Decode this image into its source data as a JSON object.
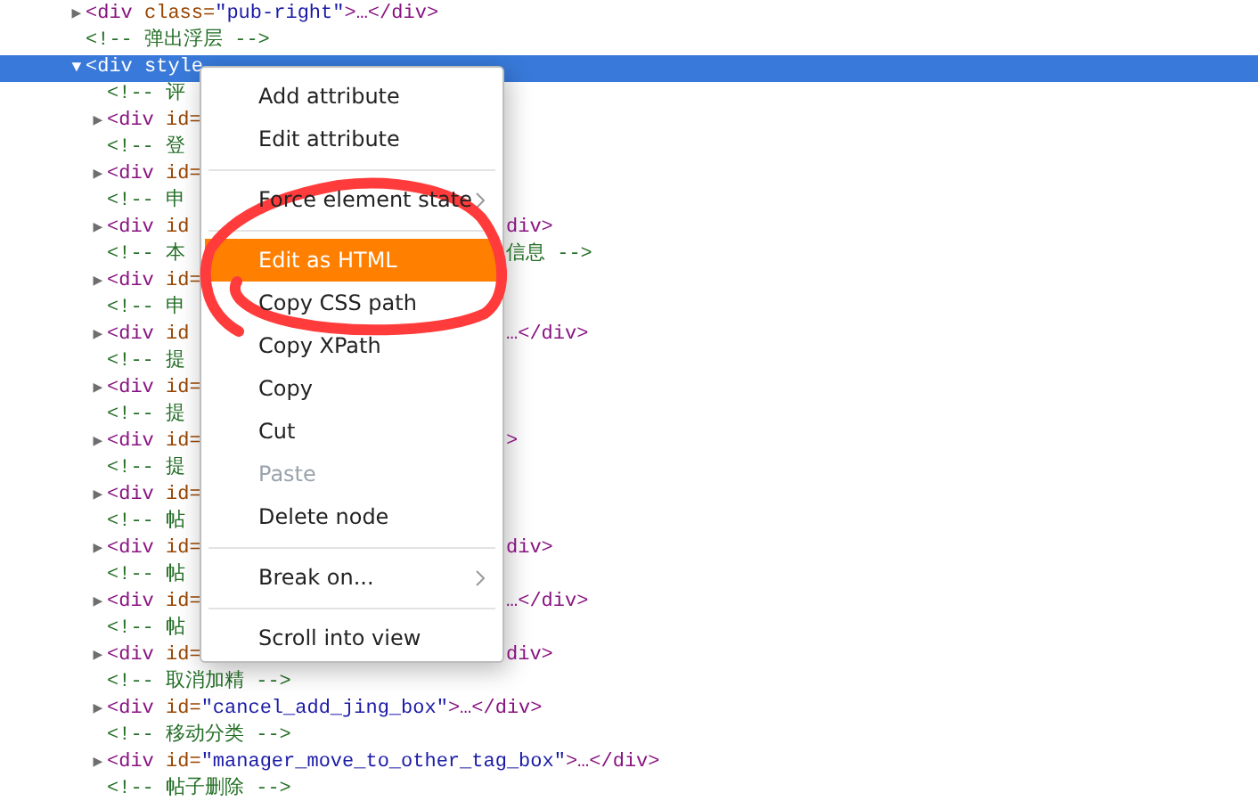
{
  "tree_rows": [
    {
      "kind": "element",
      "expander": "▶",
      "selected": false,
      "open": "<div",
      "attr": "class=",
      "value": "\"pub-right\"",
      "close": ">…</div>"
    },
    {
      "kind": "comment",
      "selected": false,
      "comment": "<!-- 弹出浮层 -->"
    },
    {
      "kind": "element",
      "expander": "▼",
      "selected": true,
      "open": "<div",
      "attr": "style",
      "children": [
        {
          "kind": "comment",
          "selected": false,
          "comment": "<!-- 评"
        },
        {
          "kind": "element",
          "expander": "▶",
          "selected": false,
          "open": "<div",
          "attr": "id="
        },
        {
          "kind": "comment",
          "selected": false,
          "comment": "<!-- 登"
        },
        {
          "kind": "element",
          "expander": "▶",
          "selected": false,
          "open": "<div",
          "attr": "id="
        },
        {
          "kind": "comment",
          "selected": false,
          "comment": "<!-- 申"
        },
        {
          "kind": "element",
          "expander": "▶",
          "selected": false,
          "open": "<div",
          "attr": "id",
          "tail_close": "div>"
        },
        {
          "kind": "comment",
          "selected": false,
          "comment": "<!-- 本",
          "tail_comment": "信息 -->"
        },
        {
          "kind": "element",
          "expander": "▶",
          "selected": false,
          "open": "<div",
          "attr": "id="
        },
        {
          "kind": "comment",
          "selected": false,
          "comment": "<!-- 申"
        },
        {
          "kind": "element",
          "expander": "▶",
          "selected": false,
          "open": "<div",
          "attr": "id",
          "tail_close": "…</div>"
        },
        {
          "kind": "comment",
          "selected": false,
          "comment": "<!-- 提"
        },
        {
          "kind": "element",
          "expander": "▶",
          "selected": false,
          "open": "<div",
          "attr": "id="
        },
        {
          "kind": "comment",
          "selected": false,
          "comment": "<!-- 提"
        },
        {
          "kind": "element",
          "expander": "▶",
          "selected": false,
          "open": "<div",
          "attr": "id=",
          "tail_close": ">"
        },
        {
          "kind": "comment",
          "selected": false,
          "comment": "<!-- 提"
        },
        {
          "kind": "element",
          "expander": "▶",
          "selected": false,
          "open": "<div",
          "attr": "id="
        },
        {
          "kind": "comment",
          "selected": false,
          "comment": "<!-- 帖"
        },
        {
          "kind": "element",
          "expander": "▶",
          "selected": false,
          "open": "<div",
          "attr": "id=",
          "tail_close": "div>"
        },
        {
          "kind": "comment",
          "selected": false,
          "comment": "<!-- 帖"
        },
        {
          "kind": "element",
          "expander": "▶",
          "selected": false,
          "open": "<div",
          "attr": "id=",
          "tail_close": "…</div>"
        },
        {
          "kind": "comment",
          "selected": false,
          "comment": "<!-- 帖"
        },
        {
          "kind": "element",
          "expander": "▶",
          "selected": false,
          "open": "<div",
          "attr": "id=",
          "tail_close": "div>"
        },
        {
          "kind": "comment",
          "selected": false,
          "comment": "<!-- 取消加精 -->"
        },
        {
          "kind": "element",
          "expander": "▶",
          "selected": false,
          "open": "<div",
          "attr": "id=",
          "value": "\"cancel_add_jing_box\"",
          "close": ">…</div>"
        },
        {
          "kind": "comment",
          "selected": false,
          "comment": "<!-- 移动分类 -->"
        },
        {
          "kind": "element",
          "expander": "▶",
          "selected": false,
          "open": "<div",
          "attr": "id=",
          "value": "\"manager_move_to_other_tag_box\"",
          "close": ">…</div>"
        },
        {
          "kind": "comment",
          "selected": false,
          "comment": "<!-- 帖子删除 -->"
        }
      ]
    }
  ],
  "context_menu": {
    "items": [
      {
        "kind": "item",
        "label": "Add attribute",
        "selected": false,
        "disabled": false
      },
      {
        "kind": "item",
        "label": "Edit attribute",
        "selected": false,
        "disabled": false
      },
      {
        "kind": "separator"
      },
      {
        "kind": "submenu",
        "label": "Force element state",
        "selected": false,
        "disabled": false
      },
      {
        "kind": "separator"
      },
      {
        "kind": "item",
        "label": "Edit as HTML",
        "selected": true,
        "disabled": false
      },
      {
        "kind": "item",
        "label": "Copy CSS path",
        "selected": false,
        "disabled": false
      },
      {
        "kind": "item",
        "label": "Copy XPath",
        "selected": false,
        "disabled": false
      },
      {
        "kind": "item",
        "label": "Copy",
        "selected": false,
        "disabled": false
      },
      {
        "kind": "item",
        "label": "Cut",
        "selected": false,
        "disabled": false
      },
      {
        "kind": "item",
        "label": "Paste",
        "selected": false,
        "disabled": true
      },
      {
        "kind": "item",
        "label": "Delete node",
        "selected": false,
        "disabled": false
      },
      {
        "kind": "separator"
      },
      {
        "kind": "submenu",
        "label": "Break on...",
        "selected": false,
        "disabled": false
      },
      {
        "kind": "separator"
      },
      {
        "kind": "item",
        "label": "Scroll into view",
        "selected": false,
        "disabled": false
      }
    ]
  }
}
